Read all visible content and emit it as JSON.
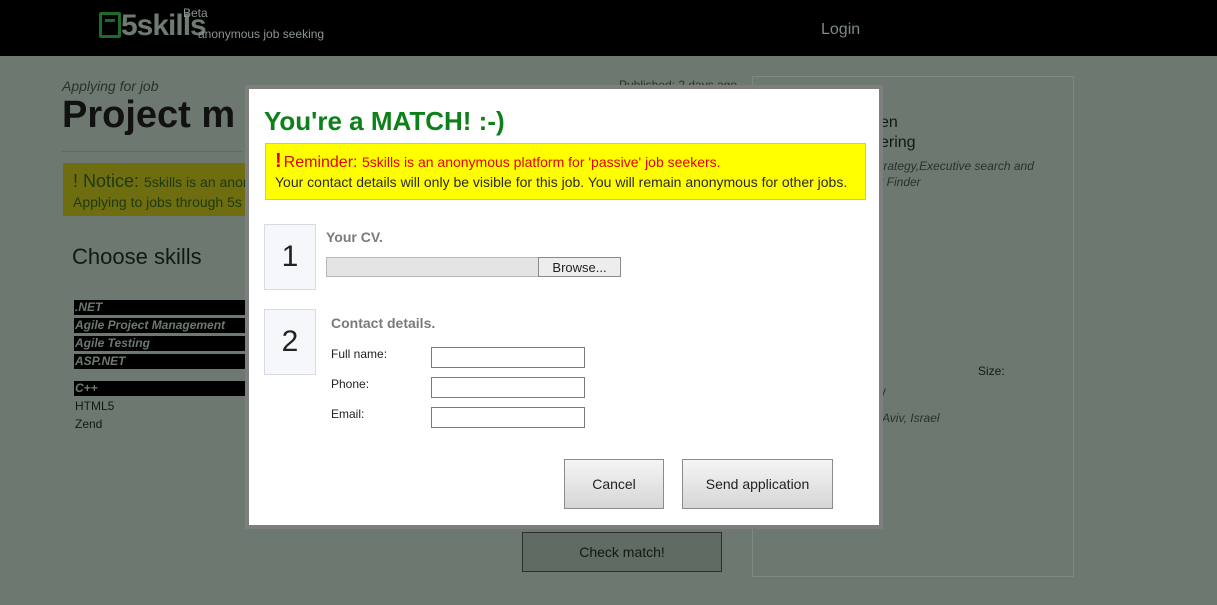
{
  "header": {
    "logo_text": "5skills",
    "beta": "Beta",
    "tagline": "anonymous job seeking",
    "login": "Login"
  },
  "background": {
    "applying": "Applying for job",
    "job_title": "Project m",
    "published": "Published: 2 days ago",
    "notice_title": "! Notice:",
    "notice_text": "5skills is an anon",
    "notice_line2": "Applying to jobs through 5s",
    "choose_skills": "Choose skills",
    "skills": [
      ".NET",
      "Agile Project Management",
      "Agile Testing",
      "ASP.NET",
      "C++",
      "HTML5",
      "Zend"
    ],
    "side_line1": "en",
    "side_line2": "ering",
    "side_line3": "trategy,Executive search and",
    "side_line4": "t Finder",
    "side_size": "Size:",
    "side_y": "y",
    "side_location": "Aviv, Israel",
    "check_match": "Check match!"
  },
  "modal": {
    "title": "You're a MATCH! :-)",
    "reminder_bang": "!",
    "reminder_label": "Reminder:",
    "reminder_text": "5skills is an anonymous platform for 'passive' job seekers.",
    "reminder_line2": "Your contact details will only be visible for this job. You will remain anonymous for other jobs.",
    "step1_number": "1",
    "step1_label": "Your CV.",
    "browse_label": "Browse...",
    "step2_number": "2",
    "step2_label": "Contact details.",
    "fields": [
      {
        "label": "Full name:",
        "value": ""
      },
      {
        "label": "Phone:",
        "value": ""
      },
      {
        "label": "Email:",
        "value": ""
      }
    ],
    "cancel_label": "Cancel",
    "send_label": "Send application"
  }
}
